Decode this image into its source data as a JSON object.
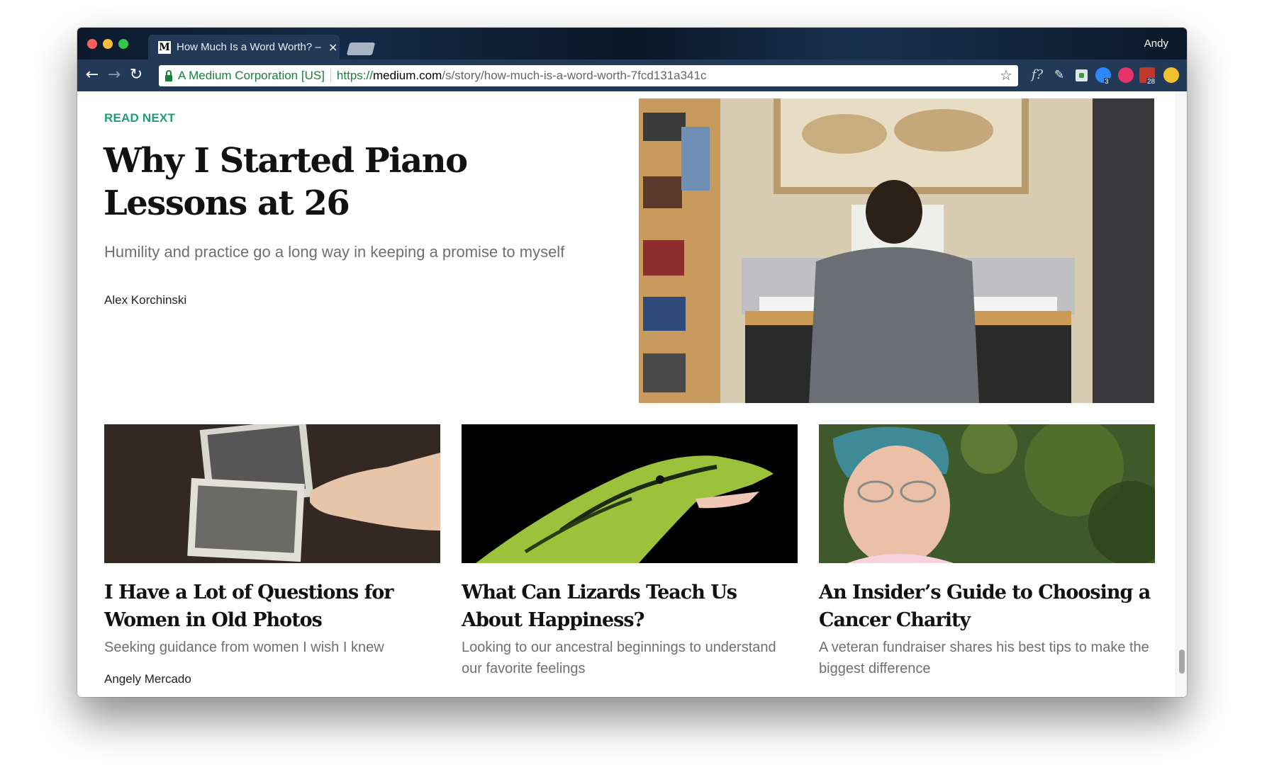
{
  "browser": {
    "tab_title": "How Much Is a Word Worth? –",
    "tab_favicon": "M",
    "tab_close": "×",
    "profile_name": "Andy",
    "back_icon": "←",
    "forward_icon": "→",
    "reload_icon": "↻",
    "secure_label": "A Medium Corporation [US]",
    "url_scheme": "https://",
    "url_host": "medium.com",
    "url_path": "/s/story/how-much-is-a-word-worth-7fcd131a341c",
    "star_icon": "☆",
    "ext_f": "f?",
    "ext_pen": "✎",
    "ext_blue_badge": "3",
    "ext_cal_badge": "28"
  },
  "read_next": {
    "kicker": "READ NEXT",
    "title": "Why I Started Piano Lessons at 26",
    "subtitle": "Humility and practice go a long way in keeping a promise to myself",
    "author": "Alex Korchinski"
  },
  "cards": [
    {
      "title": "I Have a Lot of Questions for Women in Old Photos",
      "subtitle": "Seeking guidance from women I wish I knew",
      "author": "Angely Mercado"
    },
    {
      "title": "What Can Lizards Teach Us About Happiness?",
      "subtitle": "Looking to our ancestral beginnings to understand our favorite feelings",
      "author": ""
    },
    {
      "title": "An Insider’s Guide to Choosing a Cancer Charity",
      "subtitle": "A veteran fundraiser shares his best tips to make the biggest difference",
      "author": ""
    }
  ],
  "colors": {
    "accent_green": "#20a070",
    "chrome_bar": "#223a57"
  }
}
